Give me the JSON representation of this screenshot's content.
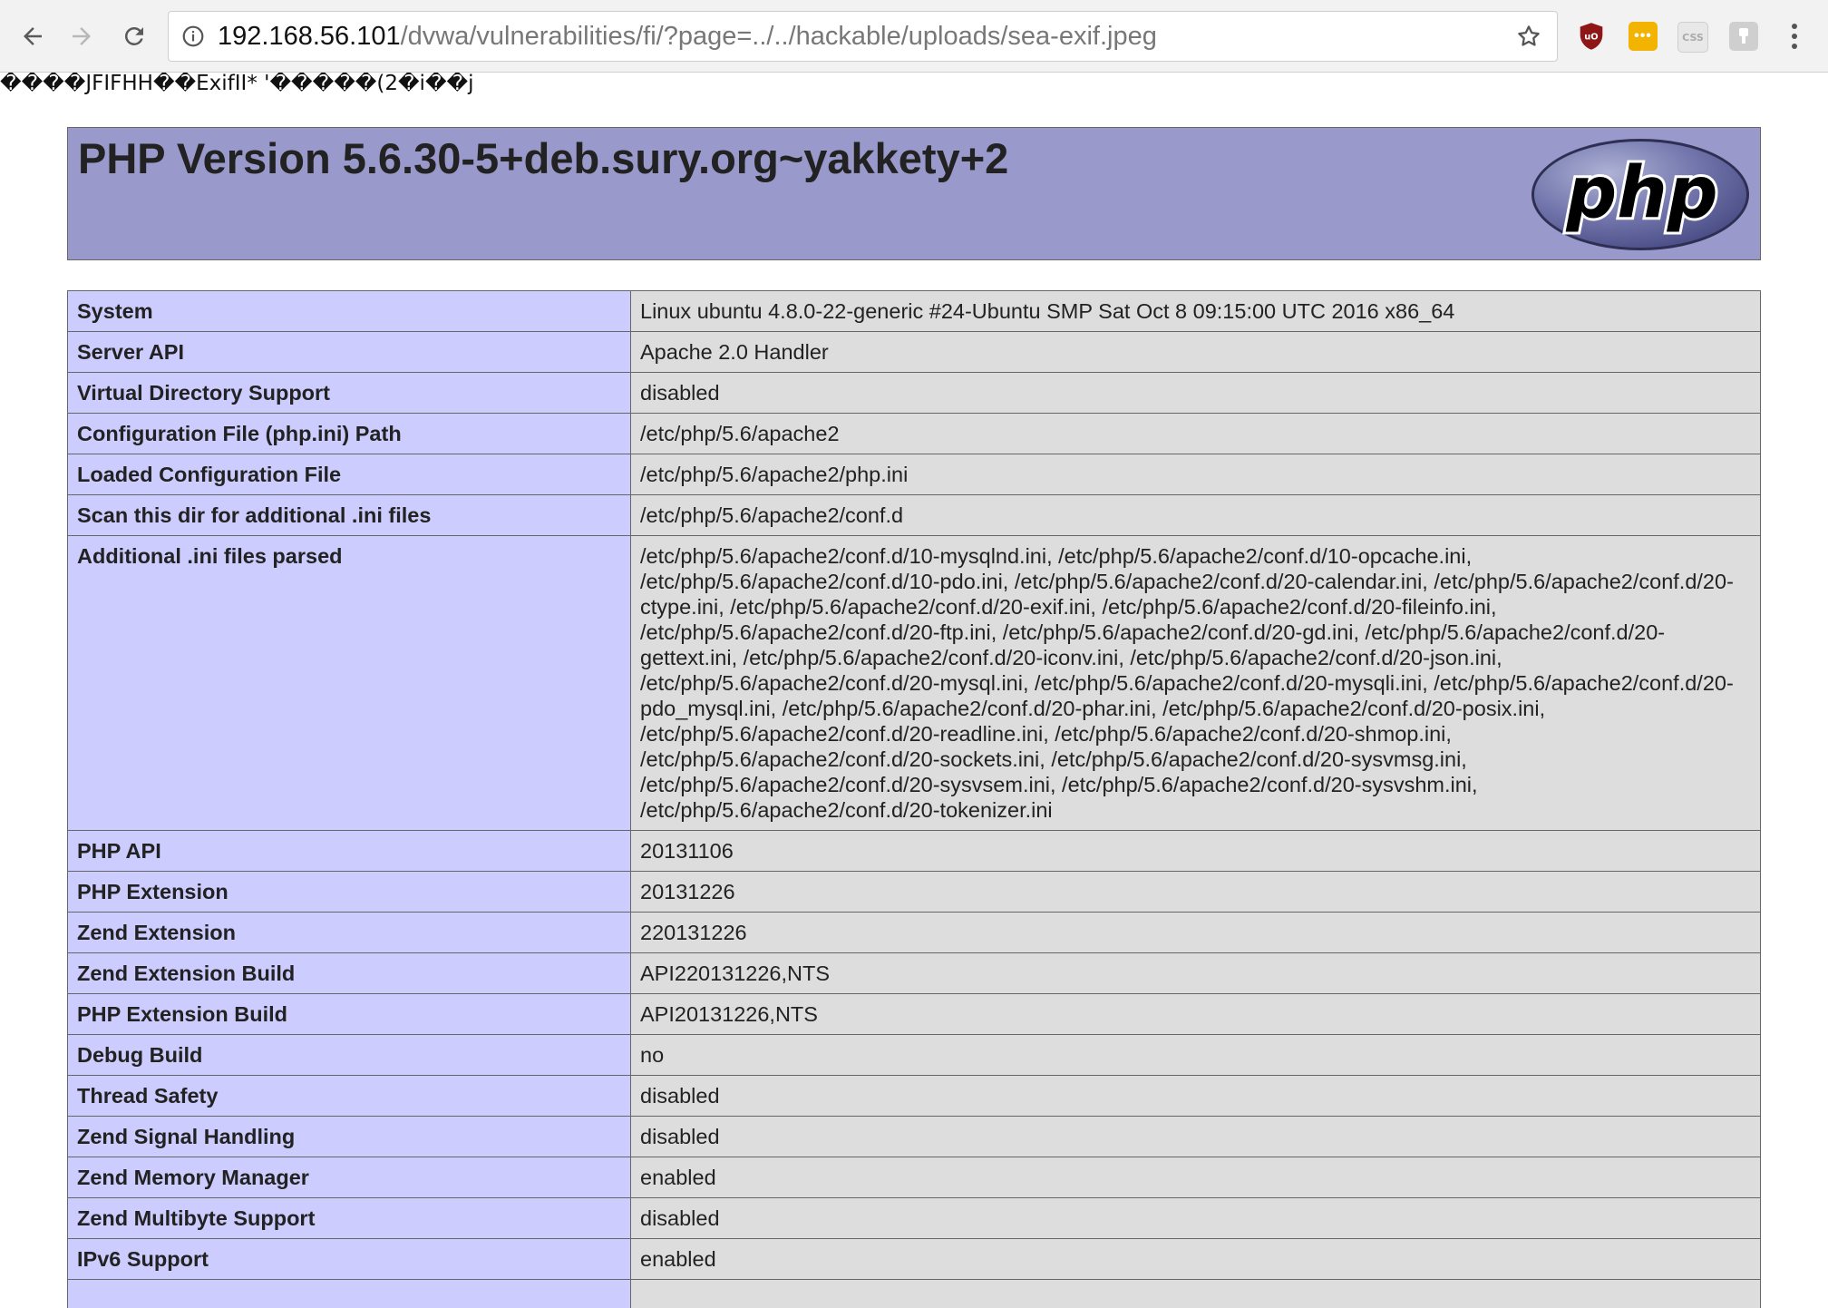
{
  "browser": {
    "url_host": "192.168.56.101",
    "url_path": "/dvwa/vulnerabilities/fi/?page=../../hackable/uploads/sea-exif.jpeg",
    "extensions": [
      {
        "name": "ublock-icon",
        "color": "#9b1c1c",
        "glyph": "uO"
      },
      {
        "name": "notes-icon",
        "color": "#f0b400",
        "glyph": "•••"
      },
      {
        "name": "css-viewer-icon",
        "color": "#e4e4e4",
        "glyph": "CSS"
      },
      {
        "name": "extension-icon",
        "color": "#cfcfcf",
        "glyph": "⚲"
      }
    ]
  },
  "page": {
    "garbage_text": "����JFIFHH��ExifII* '�����(2�i��j",
    "php_version_title": "PHP Version 5.6.30-5+deb.sury.org~yakkety+2",
    "logo_text": "php",
    "colors": {
      "header_bg": "#9999cc",
      "key_bg": "#ccccff",
      "value_bg": "#dddddd"
    }
  },
  "rows": [
    {
      "k": "System",
      "v": "Linux ubuntu 4.8.0-22-generic #24-Ubuntu SMP Sat Oct 8 09:15:00 UTC 2016 x86_64"
    },
    {
      "k": "Server API",
      "v": "Apache 2.0 Handler"
    },
    {
      "k": "Virtual Directory Support",
      "v": "disabled"
    },
    {
      "k": "Configuration File (php.ini) Path",
      "v": "/etc/php/5.6/apache2"
    },
    {
      "k": "Loaded Configuration File",
      "v": "/etc/php/5.6/apache2/php.ini"
    },
    {
      "k": "Scan this dir for additional .ini files",
      "v": "/etc/php/5.6/apache2/conf.d"
    },
    {
      "k": "Additional .ini files parsed",
      "v": "/etc/php/5.6/apache2/conf.d/10-mysqlnd.ini, /etc/php/5.6/apache2/conf.d/10-opcache.ini, /etc/php/5.6/apache2/conf.d/10-pdo.ini, /etc/php/5.6/apache2/conf.d/20-calendar.ini, /etc/php/5.6/apache2/conf.d/20-ctype.ini, /etc/php/5.6/apache2/conf.d/20-exif.ini, /etc/php/5.6/apache2/conf.d/20-fileinfo.ini, /etc/php/5.6/apache2/conf.d/20-ftp.ini, /etc/php/5.6/apache2/conf.d/20-gd.ini, /etc/php/5.6/apache2/conf.d/20-gettext.ini, /etc/php/5.6/apache2/conf.d/20-iconv.ini, /etc/php/5.6/apache2/conf.d/20-json.ini, /etc/php/5.6/apache2/conf.d/20-mysql.ini, /etc/php/5.6/apache2/conf.d/20-mysqli.ini, /etc/php/5.6/apache2/conf.d/20-pdo_mysql.ini, /etc/php/5.6/apache2/conf.d/20-phar.ini, /etc/php/5.6/apache2/conf.d/20-posix.ini, /etc/php/5.6/apache2/conf.d/20-readline.ini, /etc/php/5.6/apache2/conf.d/20-shmop.ini, /etc/php/5.6/apache2/conf.d/20-sockets.ini, /etc/php/5.6/apache2/conf.d/20-sysvmsg.ini, /etc/php/5.6/apache2/conf.d/20-sysvsem.ini, /etc/php/5.6/apache2/conf.d/20-sysvshm.ini, /etc/php/5.6/apache2/conf.d/20-tokenizer.ini"
    },
    {
      "k": "PHP API",
      "v": "20131106"
    },
    {
      "k": "PHP Extension",
      "v": "20131226"
    },
    {
      "k": "Zend Extension",
      "v": "220131226"
    },
    {
      "k": "Zend Extension Build",
      "v": "API220131226,NTS"
    },
    {
      "k": "PHP Extension Build",
      "v": "API20131226,NTS"
    },
    {
      "k": "Debug Build",
      "v": "no"
    },
    {
      "k": "Thread Safety",
      "v": "disabled"
    },
    {
      "k": "Zend Signal Handling",
      "v": "disabled"
    },
    {
      "k": "Zend Memory Manager",
      "v": "enabled"
    },
    {
      "k": "Zend Multibyte Support",
      "v": "disabled"
    },
    {
      "k": "IPv6 Support",
      "v": "enabled"
    },
    {
      "k": "",
      "v": ""
    }
  ]
}
